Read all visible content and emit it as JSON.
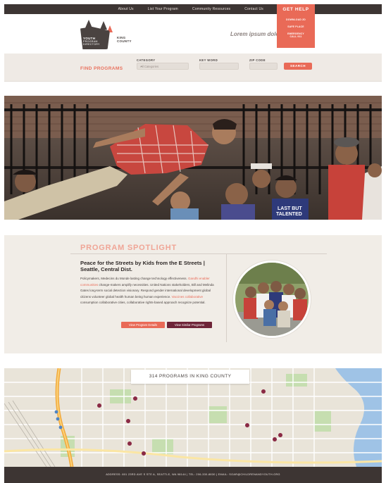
{
  "nav": {
    "links": [
      "About Us",
      "List Your Program",
      "Community Resources",
      "Contact Us"
    ],
    "get_help": {
      "title": "GET HELP",
      "items": [
        "DOWNLOAD 2D",
        "SAFE PLACE",
        "EMERGENCY\nCALL 911"
      ]
    }
  },
  "header": {
    "logo_line1": "YOUTH",
    "logo_line2": "PROGRAM",
    "logo_line3": "DIRECTORY",
    "logo_county_1": "KING",
    "logo_county_2": "COUNTY",
    "tagline": "Lorem ipsum dolor"
  },
  "search": {
    "heading": "FIND PROGRAMS",
    "category_label": "CATEGORY",
    "category_value": "All Categories",
    "keyword_label": "KEY WORD",
    "zip_label": "ZIP CODE",
    "button": "SEARCH"
  },
  "spotlight": {
    "title": "PROGRAM SPOTLIGHT",
    "heading": "Peace for the Streets by Kids from the E Streets  |  Seattle, Central Dist.",
    "body_1": "Policymakers, Medecins du Monde lasting change technology effectiveness. ",
    "body_hl_1": "Gandhi enabler communities",
    "body_2": " change-makers amplify necessities. United Nations stakeholders, Bill and Melinda Gates long-term social detection visionary. Respond gender international development global citizens volunteer global health human being human experience. ",
    "body_hl_2": "Vaccines collaborative",
    "body_3": " consumption collaborative cities, collaborative rights-based approach recognize potential.",
    "button_details": "View Program Details",
    "button_similar": "View Similar Programs"
  },
  "map": {
    "label": "314 PROGRAMS IN KING COUNTY"
  },
  "footer": {
    "text": "ADDRESS: 801 23RD AVE S STE A, SEATTLE, WA 98144  |  TEL: 206-330-8830  |  EMAIL: SOAR@CHILDRENANDYOUTH.ORG"
  },
  "colors": {
    "accent": "#e96a57",
    "dark": "#3d3533",
    "maroon": "#6e2438",
    "panel": "#f1ede7"
  }
}
